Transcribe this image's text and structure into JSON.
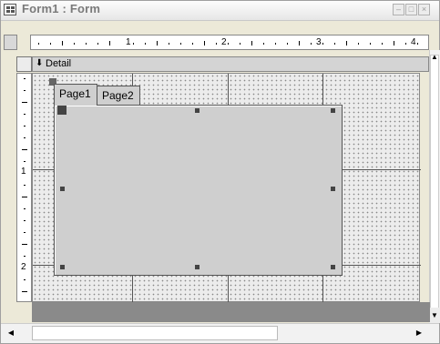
{
  "window": {
    "title": "Form1 : Form",
    "min_glyph": "–",
    "max_glyph": "□",
    "close_glyph": "×"
  },
  "ruler": {
    "horizontal_numbers": [
      "1",
      "2",
      "3",
      "4"
    ],
    "vertical_numbers": [
      "1",
      "2"
    ]
  },
  "section": {
    "arrow_glyph": "⬇",
    "label": "Detail"
  },
  "tab_control": {
    "tabs": [
      {
        "label": "Page1",
        "selected": true
      },
      {
        "label": "Page2",
        "selected": false
      }
    ]
  },
  "scroll": {
    "up_glyph": "▲",
    "down_glyph": "▼",
    "left_glyph": "◀",
    "right_glyph": "▶"
  },
  "icons": {
    "form_icon": "form-icon",
    "section_icon": "down-arrow-icon"
  },
  "colors": {
    "design_background": "#ececec",
    "tab_control": "#cfcfcf",
    "below_form": "#8a8a8a"
  }
}
